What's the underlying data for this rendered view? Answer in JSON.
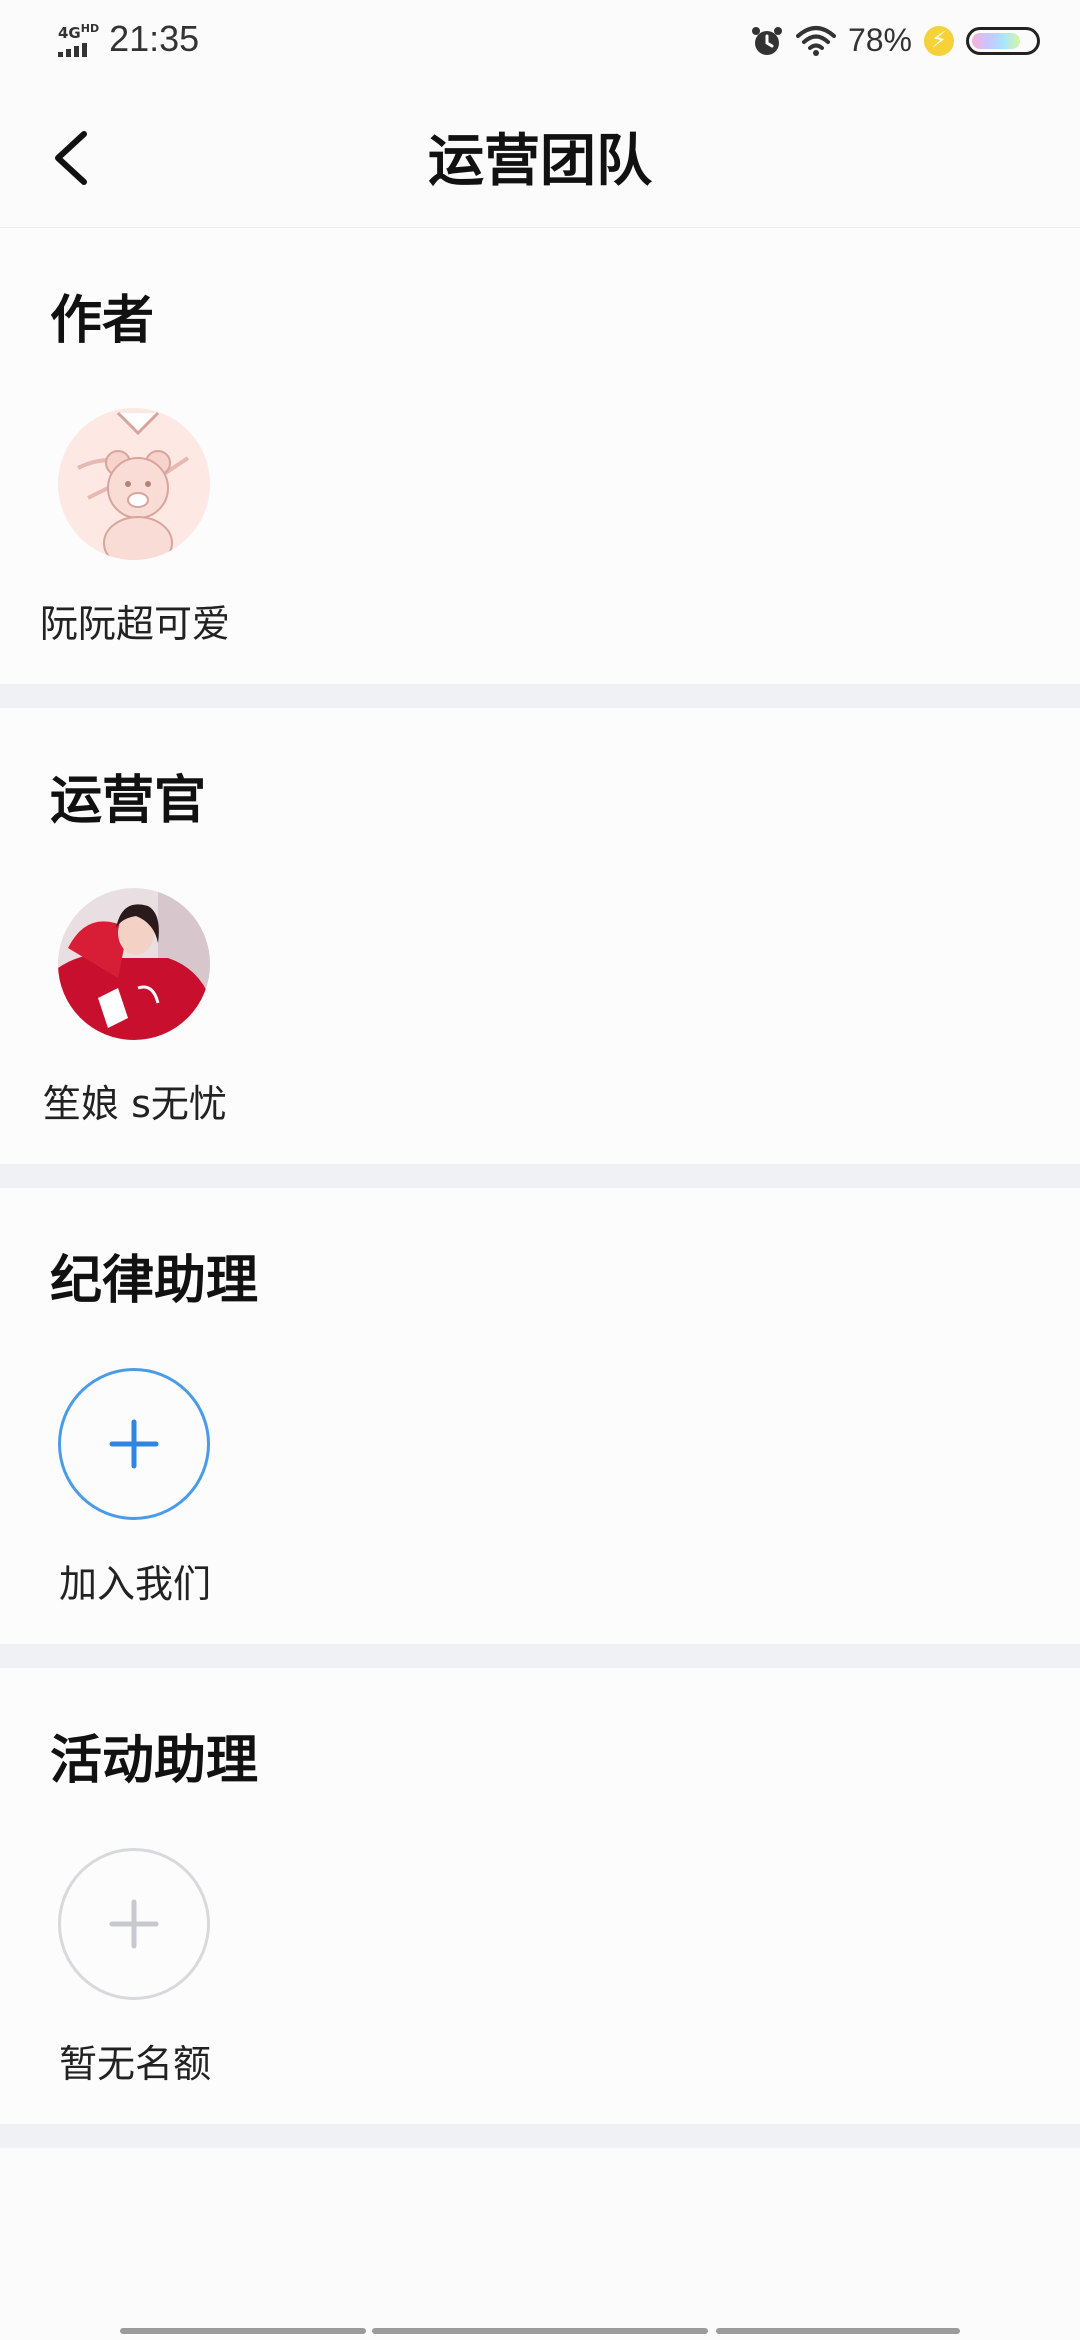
{
  "status_bar": {
    "network": "4G",
    "network_sup": "HD",
    "time": "21:35",
    "battery_percent": "78%",
    "battery_level": 0.78,
    "icons": [
      "alarm-icon",
      "wifi-icon",
      "charging-bolt-icon",
      "battery-icon"
    ]
  },
  "header": {
    "title": "运营团队",
    "back_icon": "back-chevron-icon"
  },
  "sections": [
    {
      "title": "作者",
      "member": {
        "name": "阮阮超可爱",
        "avatar": "teddy-bear-illustration"
      }
    },
    {
      "title": "运营官",
      "member": {
        "name": "笙娘 s无忧",
        "avatar": "woman-in-red-photo"
      }
    },
    {
      "title": "纪律助理",
      "member": {
        "name": "加入我们",
        "avatar": "add-icon",
        "accent": "#4a9be8"
      }
    },
    {
      "title": "活动助理",
      "member": {
        "name": "暂无名额",
        "avatar": "add-icon-disabled",
        "accent": "#d3d4d8"
      }
    }
  ],
  "colors": {
    "background": "#fcfcfd",
    "divider": "#eff1f4",
    "accent_blue": "#4a9be8"
  }
}
